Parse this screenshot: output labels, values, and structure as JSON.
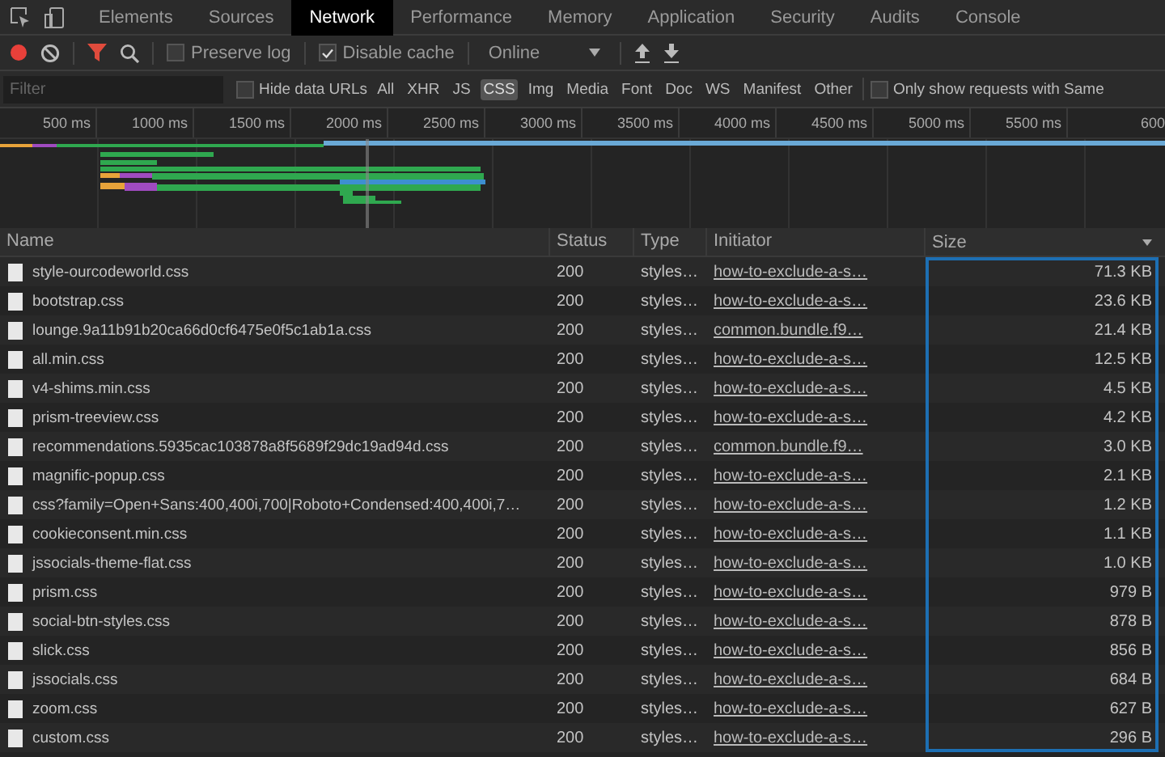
{
  "panel_tabs": [
    {
      "label": "Elements",
      "selected": false
    },
    {
      "label": "Sources",
      "selected": false
    },
    {
      "label": "Network",
      "selected": true
    },
    {
      "label": "Performance",
      "selected": false
    },
    {
      "label": "Memory",
      "selected": false
    },
    {
      "label": "Application",
      "selected": false
    },
    {
      "label": "Security",
      "selected": false
    },
    {
      "label": "Audits",
      "selected": false
    },
    {
      "label": "Console",
      "selected": false
    }
  ],
  "toolbar": {
    "preserve_log": {
      "label": "Preserve log",
      "checked": false
    },
    "disable_cache": {
      "label": "Disable cache",
      "checked": true
    },
    "throttle": "Online"
  },
  "filter_bar": {
    "placeholder": "Filter",
    "hide_data_urls": {
      "label": "Hide data URLs",
      "checked": false
    },
    "type_filters": [
      {
        "label": "All",
        "selected": false
      },
      {
        "label": "XHR",
        "selected": false
      },
      {
        "label": "JS",
        "selected": false
      },
      {
        "label": "CSS",
        "selected": true
      },
      {
        "label": "Img",
        "selected": false
      },
      {
        "label": "Media",
        "selected": false
      },
      {
        "label": "Font",
        "selected": false
      },
      {
        "label": "Doc",
        "selected": false
      },
      {
        "label": "WS",
        "selected": false
      },
      {
        "label": "Manifest",
        "selected": false
      },
      {
        "label": "Other",
        "selected": false
      }
    ],
    "same_site": {
      "label": "Only show requests with Same",
      "checked": false
    }
  },
  "timeline": {
    "ticks": [
      "500 ms",
      "1000 ms",
      "1500 ms",
      "2000 ms",
      "2500 ms",
      "3000 ms",
      "3500 ms",
      "4000 ms",
      "4500 ms",
      "5000 ms",
      "5500 ms",
      "600"
    ]
  },
  "table": {
    "columns": [
      "Name",
      "Status",
      "Type",
      "Initiator",
      "Size"
    ],
    "rows": [
      {
        "name": "style-ourcodeworld.css",
        "status": "200",
        "type": "styles…",
        "initiator": "how-to-exclude-a-s…",
        "size": "71.3 KB"
      },
      {
        "name": "bootstrap.css",
        "status": "200",
        "type": "styles…",
        "initiator": "how-to-exclude-a-s…",
        "size": "23.6 KB"
      },
      {
        "name": "lounge.9a11b91b20ca66d0cf6475e0f5c1ab1a.css",
        "status": "200",
        "type": "styles…",
        "initiator": "common.bundle.f9…",
        "size": "21.4 KB"
      },
      {
        "name": "all.min.css",
        "status": "200",
        "type": "styles…",
        "initiator": "how-to-exclude-a-s…",
        "size": "12.5 KB"
      },
      {
        "name": "v4-shims.min.css",
        "status": "200",
        "type": "styles…",
        "initiator": "how-to-exclude-a-s…",
        "size": "4.5 KB"
      },
      {
        "name": "prism-treeview.css",
        "status": "200",
        "type": "styles…",
        "initiator": "how-to-exclude-a-s…",
        "size": "4.2 KB"
      },
      {
        "name": "recommendations.5935cac103878a8f5689f29dc19ad94d.css",
        "status": "200",
        "type": "styles…",
        "initiator": "common.bundle.f9…",
        "size": "3.0 KB"
      },
      {
        "name": "magnific-popup.css",
        "status": "200",
        "type": "styles…",
        "initiator": "how-to-exclude-a-s…",
        "size": "2.1 KB"
      },
      {
        "name": "css?family=Open+Sans:400,400i,700|Roboto+Condensed:400,400i,7…",
        "status": "200",
        "type": "styles…",
        "initiator": "how-to-exclude-a-s…",
        "size": "1.2 KB"
      },
      {
        "name": "cookieconsent.min.css",
        "status": "200",
        "type": "styles…",
        "initiator": "how-to-exclude-a-s…",
        "size": "1.1 KB"
      },
      {
        "name": "jssocials-theme-flat.css",
        "status": "200",
        "type": "styles…",
        "initiator": "how-to-exclude-a-s…",
        "size": "1.0 KB"
      },
      {
        "name": "prism.css",
        "status": "200",
        "type": "styles…",
        "initiator": "how-to-exclude-a-s…",
        "size": "979 B"
      },
      {
        "name": "social-btn-styles.css",
        "status": "200",
        "type": "styles…",
        "initiator": "how-to-exclude-a-s…",
        "size": "878 B"
      },
      {
        "name": "slick.css",
        "status": "200",
        "type": "styles…",
        "initiator": "how-to-exclude-a-s…",
        "size": "856 B"
      },
      {
        "name": "jssocials.css",
        "status": "200",
        "type": "styles…",
        "initiator": "how-to-exclude-a-s…",
        "size": "684 B"
      },
      {
        "name": "zoom.css",
        "status": "200",
        "type": "styles…",
        "initiator": "how-to-exclude-a-s…",
        "size": "627 B"
      },
      {
        "name": "custom.css",
        "status": "200",
        "type": "styles…",
        "initiator": "how-to-exclude-a-s…",
        "size": "296 B"
      }
    ]
  }
}
